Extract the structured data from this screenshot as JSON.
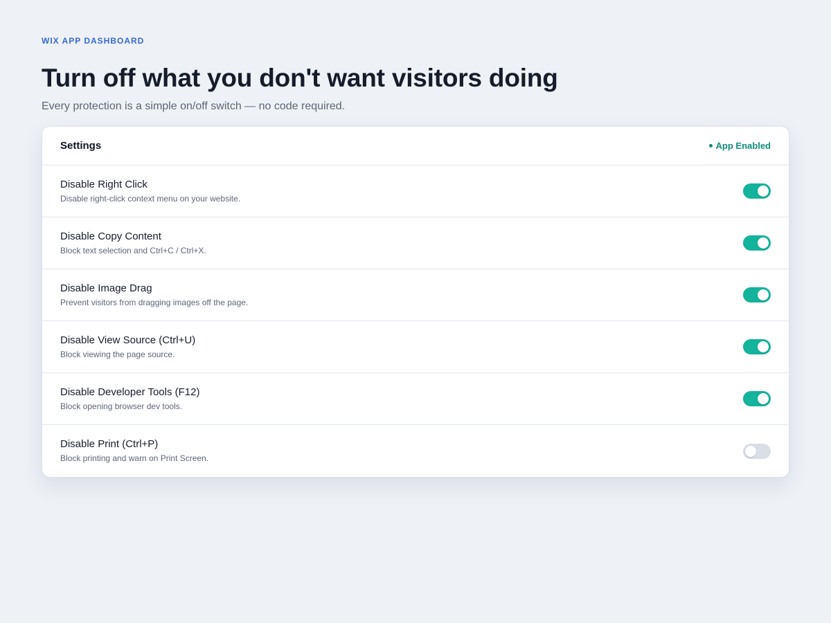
{
  "header": {
    "eyebrow": "WIX APP DASHBOARD",
    "title": "Turn off what you don't want visitors doing",
    "subtitle": "Every protection is a simple on/off switch — no code required."
  },
  "settings": {
    "title": "Settings",
    "status": "App Enabled",
    "status_color": "#0f8c7a",
    "toggle_on_color": "#14b39b",
    "toggle_off_color": "#d9dee7",
    "items": [
      {
        "label": "Disable Right Click",
        "description": "Disable right-click context menu on your website.",
        "enabled": true
      },
      {
        "label": "Disable Copy Content",
        "description": "Block text selection and Ctrl+C / Ctrl+X.",
        "enabled": true
      },
      {
        "label": "Disable Image Drag",
        "description": "Prevent visitors from dragging images off the page.",
        "enabled": true
      },
      {
        "label": "Disable View Source (Ctrl+U)",
        "description": "Block viewing the page source.",
        "enabled": true
      },
      {
        "label": "Disable Developer Tools (F12)",
        "description": "Block opening browser dev tools.",
        "enabled": true
      },
      {
        "label": "Disable Print (Ctrl+P)",
        "description": "Block printing and warn on Print Screen.",
        "enabled": false
      }
    ]
  }
}
